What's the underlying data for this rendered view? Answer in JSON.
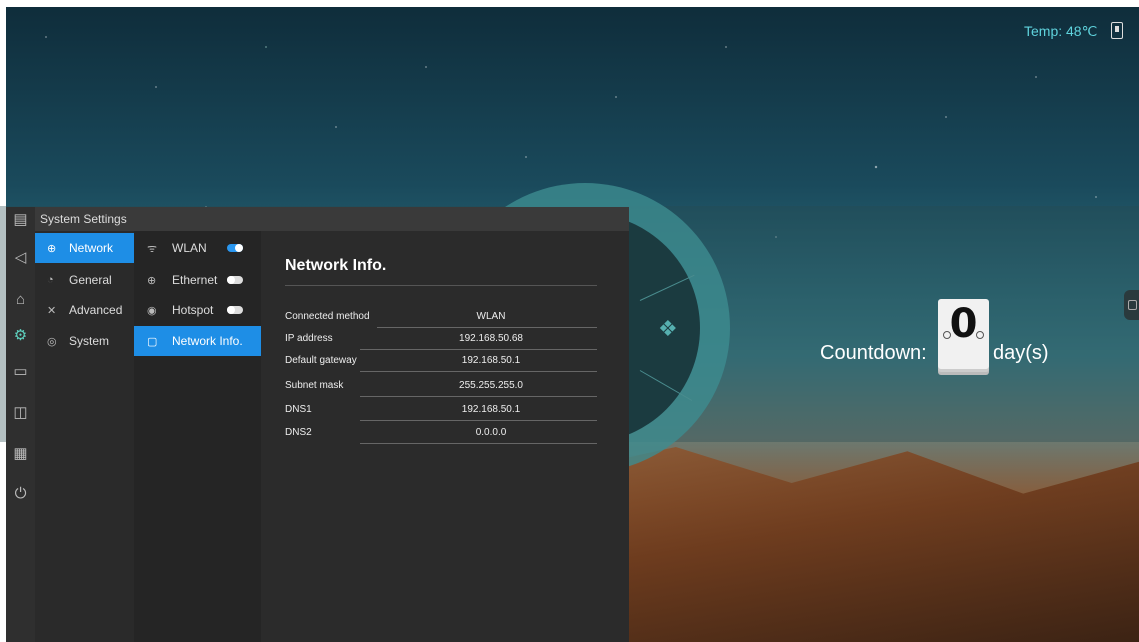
{
  "status": {
    "temp_label": "Temp: 48℃"
  },
  "countdown": {
    "label": "Countdown:",
    "digit": "0",
    "unit": "day(s)"
  },
  "dock": {
    "items": [
      "back-icon",
      "home-icon",
      "settings-icon",
      "folder-icon",
      "camera-icon",
      "keyboard-icon",
      "power-icon"
    ]
  },
  "window": {
    "title": "System Settings",
    "nav": [
      {
        "label": "Network",
        "icon": "globe-icon",
        "glyph": "⊕",
        "active": true
      },
      {
        "label": "General",
        "icon": "palette-icon",
        "glyph": "◔",
        "active": false
      },
      {
        "label": "Advanced",
        "icon": "tools-icon",
        "glyph": "✕",
        "active": false
      },
      {
        "label": "System",
        "icon": "system-icon",
        "glyph": "◎",
        "active": false
      }
    ],
    "sub": [
      {
        "label": "WLAN",
        "icon": "wifi-icon",
        "glyph": "ᯤ",
        "toggle": "on"
      },
      {
        "label": "Ethernet",
        "icon": "ethernet-icon",
        "glyph": "⊕",
        "toggle": "off"
      },
      {
        "label": "Hotspot",
        "icon": "hotspot-icon",
        "glyph": "◉",
        "toggle": "off"
      },
      {
        "label": "Network Info.",
        "icon": "info-icon",
        "glyph": "▢",
        "toggle": null,
        "active": true
      }
    ],
    "panel": {
      "title": "Network Info.",
      "rows": [
        {
          "key": "Connected method",
          "value": "WLAN"
        },
        {
          "key": "IP address",
          "value": "192.168.50.68"
        },
        {
          "key": "Default gateway",
          "value": "192.168.50.1"
        },
        {
          "key": "Subnet mask",
          "value": "255.255.255.0"
        },
        {
          "key": "DNS1",
          "value": "192.168.50.1"
        },
        {
          "key": "DNS2",
          "value": "0.0.0.0"
        }
      ]
    }
  }
}
